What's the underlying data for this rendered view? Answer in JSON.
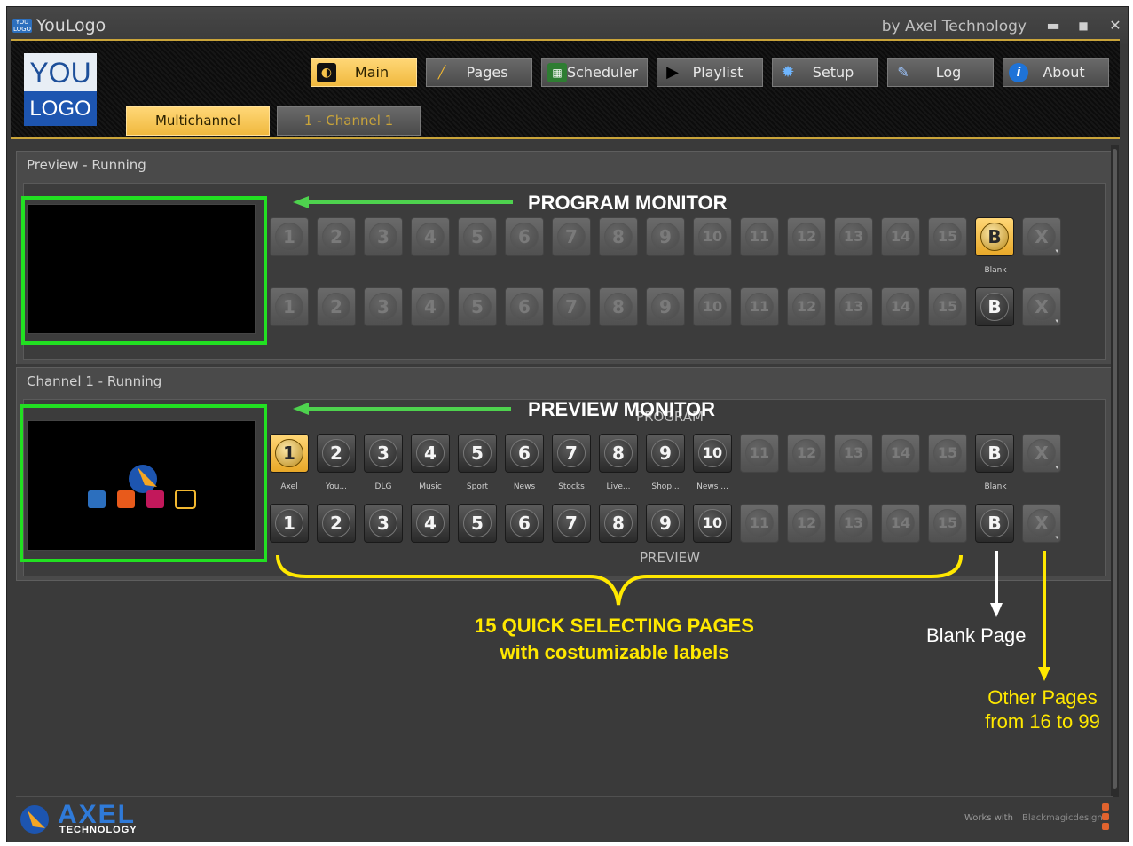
{
  "app": {
    "title": "YouLogo",
    "by": "by Axel Technology",
    "icon_text": "YOU LOGO"
  },
  "window_controls": {
    "minimize": "▬",
    "maximize": "■",
    "close": "✕"
  },
  "logo": {
    "top": "YOU",
    "bottom": "LOGO"
  },
  "nav": [
    {
      "label": "Main",
      "icon": "main-icon",
      "active": true
    },
    {
      "label": "Pages",
      "icon": "pencil-icon",
      "active": false
    },
    {
      "label": "Scheduler",
      "icon": "calendar-icon",
      "active": false
    },
    {
      "label": "Playlist",
      "icon": "play-icon",
      "active": false
    },
    {
      "label": "Setup",
      "icon": "gear-icon",
      "active": false
    },
    {
      "label": "Log",
      "icon": "log-icon",
      "active": false
    },
    {
      "label": "About",
      "icon": "info-icon",
      "active": false
    }
  ],
  "tabs": [
    {
      "label": "Multichannel",
      "active": true
    },
    {
      "label": "1 - Channel 1",
      "active": false
    }
  ],
  "preview_panel": {
    "title": "Preview - Running",
    "row1": [
      "1",
      "2",
      "3",
      "4",
      "5",
      "6",
      "7",
      "8",
      "9",
      "10",
      "11",
      "12",
      "13",
      "14",
      "15",
      "B",
      "X"
    ],
    "row2": [
      "1",
      "2",
      "3",
      "4",
      "5",
      "6",
      "7",
      "8",
      "9",
      "10",
      "11",
      "12",
      "13",
      "14",
      "15",
      "B",
      "X"
    ],
    "blank_label": "Blank"
  },
  "channel_panel": {
    "title": "Channel 1 - Running",
    "program_label": "PROGRAM",
    "preview_label": "PREVIEW",
    "row1": [
      "1",
      "2",
      "3",
      "4",
      "5",
      "6",
      "7",
      "8",
      "9",
      "10",
      "11",
      "12",
      "13",
      "14",
      "15",
      "B",
      "X"
    ],
    "row2": [
      "1",
      "2",
      "3",
      "4",
      "5",
      "6",
      "7",
      "8",
      "9",
      "10",
      "11",
      "12",
      "13",
      "14",
      "15",
      "B",
      "X"
    ],
    "page_labels": [
      "Axel",
      "You...",
      "DLG",
      "Music",
      "Sport",
      "News",
      "Stocks",
      "Live...",
      "Shop...",
      "News ..."
    ],
    "blank_label": "Blank"
  },
  "annotations": {
    "program_monitor": "PROGRAM MONITOR",
    "preview_monitor": "PREVIEW MONITOR",
    "quick_pages_1": "15 QUICK SELECTING PAGES",
    "quick_pages_2": "with costumizable labels",
    "blank_page": "Blank Page",
    "other_pages_1": "Other Pages",
    "other_pages_2": "from 16 to 99"
  },
  "footer": {
    "brand_big": "AXEL",
    "brand_small": "TECHNOLOGY",
    "works_with": "Works with",
    "blackmagic": "Blackmagicdesign"
  },
  "colors": {
    "accent": "#f5c24a",
    "green": "#22e022",
    "yellow": "#ffe800",
    "arrow_green": "#4ed24e"
  }
}
